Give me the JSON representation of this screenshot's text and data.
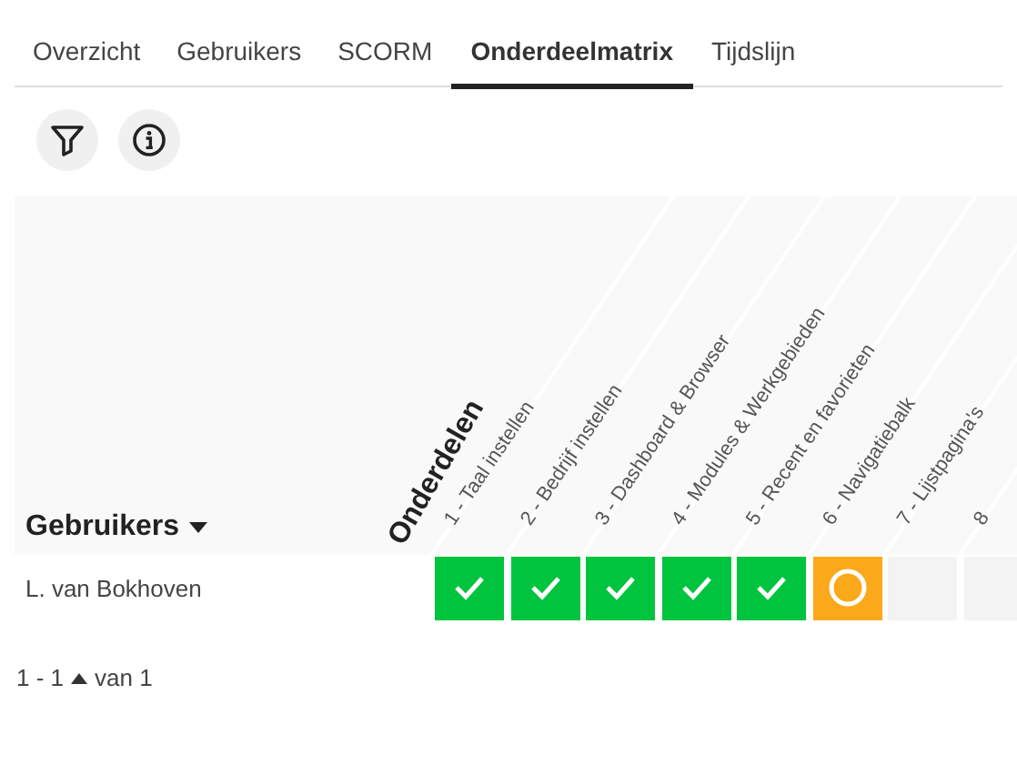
{
  "tabs": [
    {
      "label": "Overzicht",
      "selected": false
    },
    {
      "label": "Gebruikers",
      "selected": false
    },
    {
      "label": "SCORM",
      "selected": false
    },
    {
      "label": "Onderdeelmatrix",
      "selected": true
    },
    {
      "label": "Tijdslijn",
      "selected": false
    }
  ],
  "toolbar": [
    {
      "kind": "filter"
    },
    {
      "kind": "info"
    }
  ],
  "matrix": {
    "row_header": "Gebruikers",
    "column_group": "Onderdelen",
    "columns": [
      "1 - Taal instellen",
      "2 - Bedrijf instellen",
      "3 - Dashboard & Browser",
      "4 - Modules & Werkgebieden",
      "5 - Recent en favorieten",
      "6 - Navigatiebalk",
      "7 - Lijstpagina's",
      "8"
    ],
    "rows": [
      {
        "name": "L. van Bokhoven",
        "cells": [
          {
            "kind": "done"
          },
          {
            "kind": "done"
          },
          {
            "kind": "done"
          },
          {
            "kind": "done"
          },
          {
            "kind": "done"
          },
          {
            "kind": "pending"
          },
          {
            "kind": "empty"
          },
          {
            "kind": "empty"
          }
        ]
      }
    ]
  },
  "pagination": {
    "range": "1 - 1",
    "of": "van 1"
  }
}
